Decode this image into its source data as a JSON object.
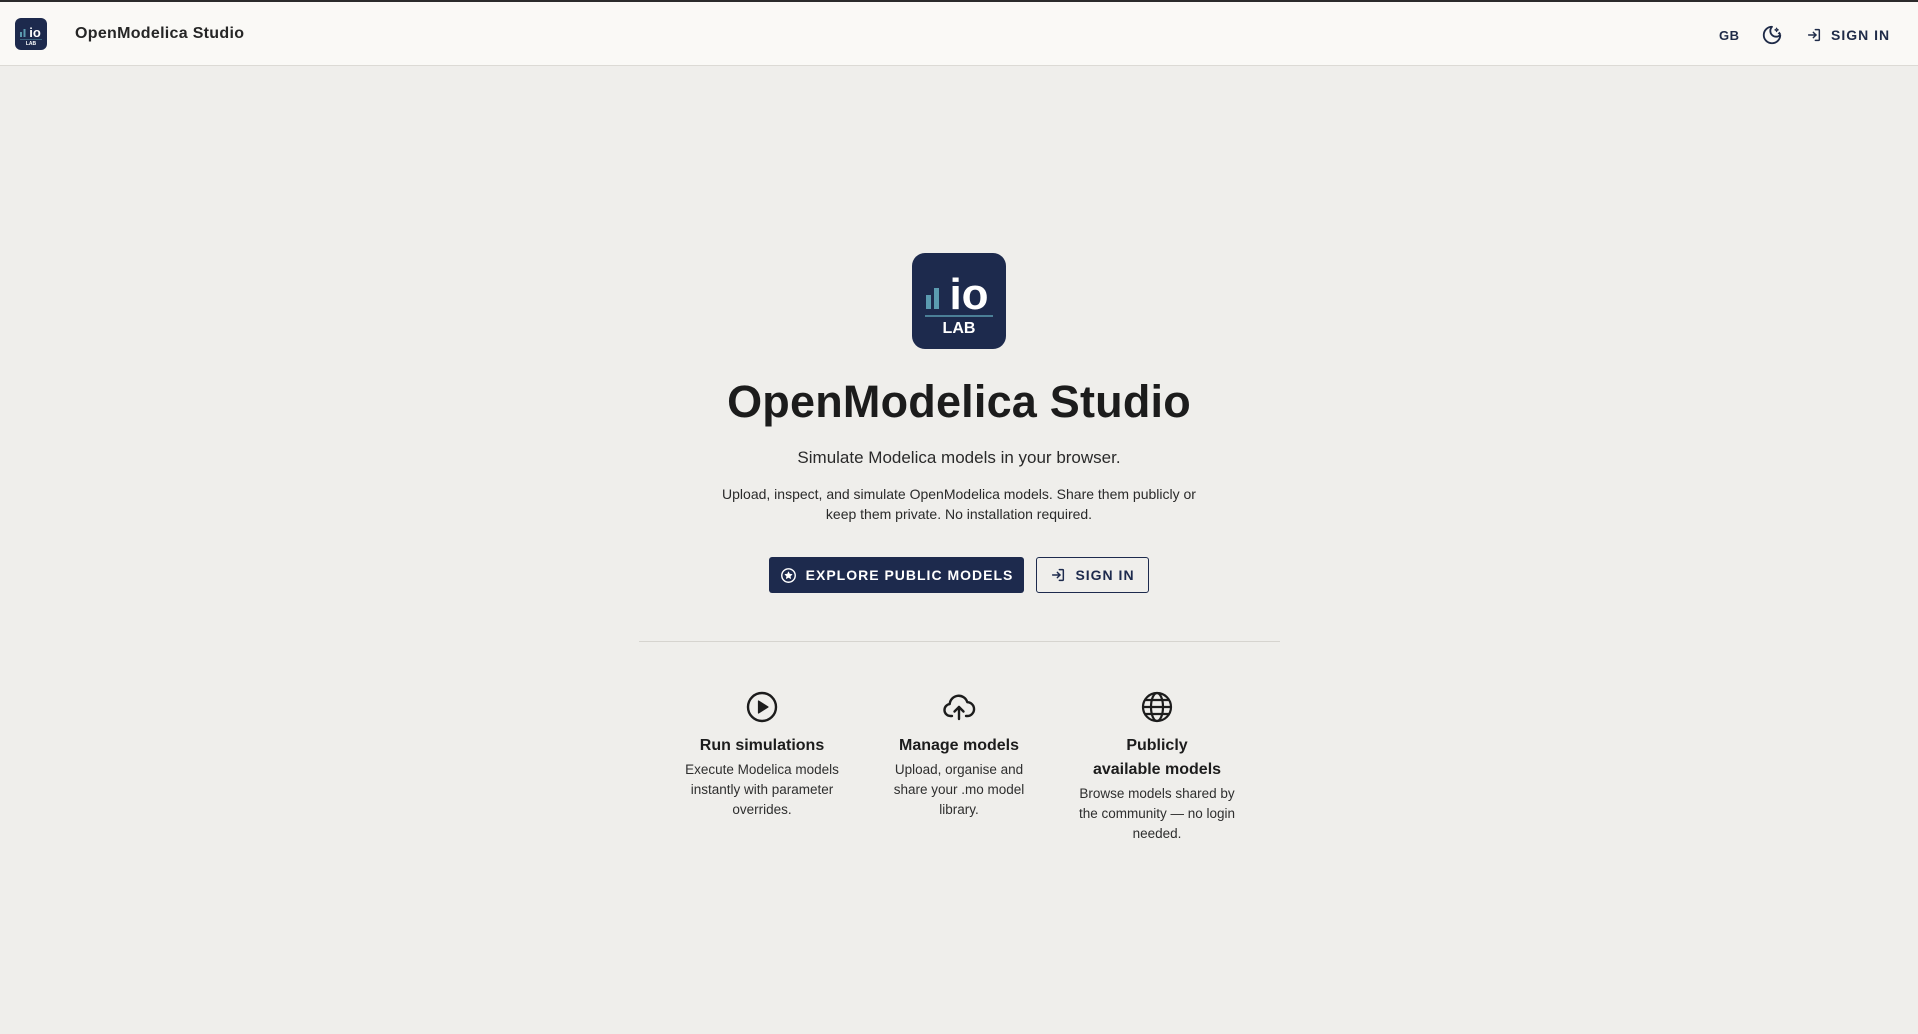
{
  "header": {
    "title": "OpenModelica Studio",
    "logo": {
      "text": "io",
      "subtext": "LAB"
    },
    "language": "GB",
    "theme_icon": "moon-icon",
    "signin_label": "SIGN IN",
    "signin_icon": "login-icon"
  },
  "hero": {
    "logo": {
      "text": "io",
      "subtext": "LAB"
    },
    "title": "OpenModelica Studio",
    "tagline": "Simulate Modelica models in your browser.",
    "description": "Upload, inspect, and simulate OpenModelica models. Share them publicly or keep them private. No installation required.",
    "explore_button": {
      "label": "EXPLORE PUBLIC MODELS",
      "icon": "star-circle-icon"
    },
    "signin_button": {
      "label": "SIGN IN",
      "icon": "login-icon"
    }
  },
  "features": [
    {
      "icon": "play-circle-icon",
      "title": "Run simulations",
      "description": "Execute Modelica models instantly with parameter overrides."
    },
    {
      "icon": "cloud-upload-icon",
      "title": "Manage models",
      "description": "Upload, organise and share your .mo model library."
    },
    {
      "icon": "globe-icon",
      "title": "Publicly available models",
      "description": "Browse models shared by the community — no login needed."
    }
  ],
  "colors": {
    "brand_navy": "#1d2a4d",
    "page_background": "#efeeeb",
    "header_background": "#faf9f6",
    "logo_accent": "#5b9bb0"
  }
}
